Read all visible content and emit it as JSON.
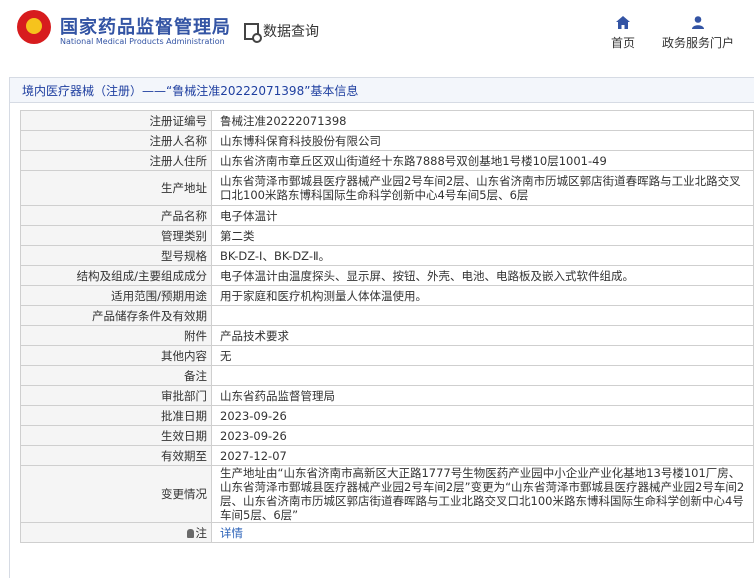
{
  "header": {
    "brand_cn": "国家药品监督管理局",
    "brand_en": "National Medical Products Administration",
    "query_label": "数据查询",
    "nav": [
      {
        "label": "首页",
        "icon": "home-icon"
      },
      {
        "label": "政务服务门户",
        "icon": "user-icon"
      }
    ]
  },
  "breadcrumb": "境内医疗器械（注册）——“鲁械注准20222071398”基本信息",
  "record": {
    "rows": [
      {
        "label": "注册证编号",
        "value": "鲁械注准20222071398"
      },
      {
        "label": "注册人名称",
        "value": "山东博科保育科技股份有限公司"
      },
      {
        "label": "注册人住所",
        "value": "山东省济南市章丘区双山街道经十东路7888号双创基地1号楼10层1001-49"
      },
      {
        "label": "生产地址",
        "value": "山东省菏泽市鄄城县医疗器械产业园2号车间2层、山东省济南市历城区郭店街道春晖路与工业北路交叉口北100米路东博科国际生命科学创新中心4号车间5层、6层"
      },
      {
        "label": "产品名称",
        "value": "电子体温计"
      },
      {
        "label": "管理类别",
        "value": "第二类"
      },
      {
        "label": "型号规格",
        "value": "BK-DZ-Ⅰ、BK-DZ-Ⅱ。"
      },
      {
        "label": "结构及组成/主要组成成分",
        "value": "电子体温计由温度探头、显示屏、按钮、外壳、电池、电路板及嵌入式软件组成。"
      },
      {
        "label": "适用范围/预期用途",
        "value": "用于家庭和医疗机构测量人体体温使用。"
      },
      {
        "label": "产品储存条件及有效期",
        "value": ""
      },
      {
        "label": "附件",
        "value": "产品技术要求"
      },
      {
        "label": "其他内容",
        "value": "无"
      },
      {
        "label": "备注",
        "value": ""
      },
      {
        "label": "审批部门",
        "value": "山东省药品监督管理局"
      },
      {
        "label": "批准日期",
        "value": "2023-09-26"
      },
      {
        "label": "生效日期",
        "value": "2023-09-26"
      },
      {
        "label": "有效期至",
        "value": "2027-12-07"
      },
      {
        "label": "变更情况",
        "value": "生产地址由“山东省济南市高新区大正路1777号生物医药产业园中小企业产业化基地13号楼101厂房、山东省菏泽市鄄城县医疗器械产业园2号车间2层”变更为“山东省菏泽市鄄城县医疗器械产业园2号车间2层、山东省济南市历城区郭店街道春晖路与工业北路交叉口北100米路东博科国际生命科学创新中心4号车间5层、6层”"
      }
    ],
    "note": {
      "label": "注",
      "value": "详情"
    }
  },
  "colors": {
    "brand": "#3354a4",
    "link": "#2a61b8",
    "logo_red": "#d71c1e"
  }
}
